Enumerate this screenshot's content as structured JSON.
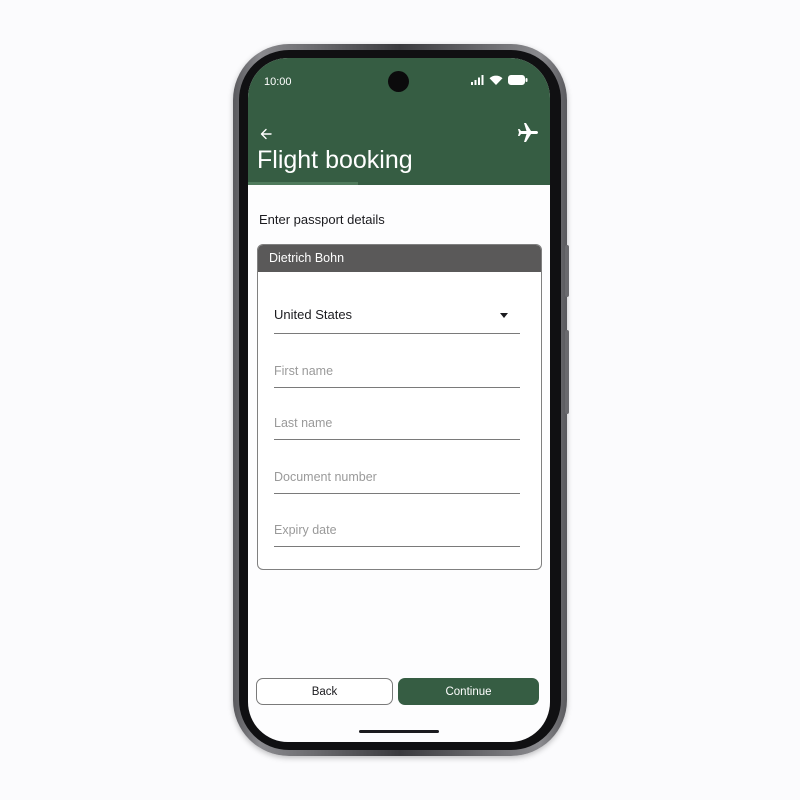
{
  "status_bar": {
    "time": "10:00"
  },
  "header": {
    "title": "Flight booking",
    "back_icon": "arrow-left-icon",
    "plane_icon": "airplane-icon",
    "color": "#365d43"
  },
  "form": {
    "section_label": "Enter passport details",
    "passenger_name": "Dietrich Bohn",
    "country": {
      "selected": "United States"
    },
    "fields": {
      "first_name_placeholder": "First name",
      "last_name_placeholder": "Last name",
      "document_number_placeholder": "Document number",
      "expiry_date_placeholder": "Expiry date"
    }
  },
  "actions": {
    "back_label": "Back",
    "continue_label": "Continue"
  },
  "colors": {
    "accent": "#365d43",
    "card_header": "#5a5959"
  }
}
